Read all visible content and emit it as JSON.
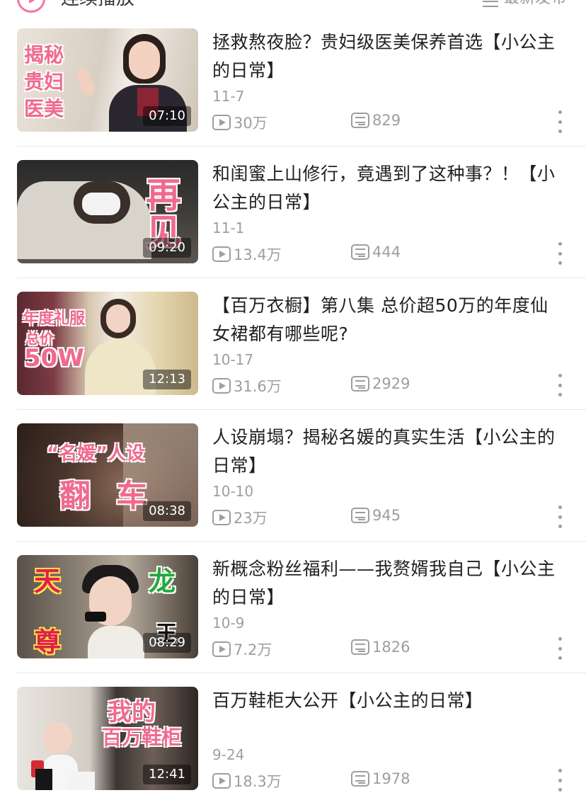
{
  "header": {
    "autoplay_label": "连续播放",
    "sort_label": "最新发布"
  },
  "videos": [
    {
      "title": "拯救熬夜脸？贵妇级医美保养首选【小公主的日常】",
      "date": "11-7",
      "views": "30万",
      "danmaku": "829",
      "duration": "07:10",
      "cover_text": [
        "揭秘",
        "贵妇",
        "医美"
      ]
    },
    {
      "title": "和闺蜜上山修行，竟遇到了这种事？！【小公主的日常】",
      "date": "11-1",
      "views": "13.4万",
      "danmaku": "444",
      "duration": "09:20",
      "cover_text": [
        "再",
        "见"
      ]
    },
    {
      "title": "【百万衣橱】第八集  总价超50万的年度仙女裙都有哪些呢?",
      "date": "10-17",
      "views": "31.6万",
      "danmaku": "2929",
      "duration": "12:13",
      "cover_text": [
        "年度礼服",
        "总价",
        "50W"
      ]
    },
    {
      "title": "人设崩塌？揭秘名媛的真实生活【小公主的日常】",
      "date": "10-10",
      "views": "23万",
      "danmaku": "945",
      "duration": "08:38",
      "cover_text": [
        "“名媛”人设",
        "翻",
        "车"
      ]
    },
    {
      "title": "新概念粉丝福利——我赘婿我自己【小公主的日常】",
      "date": "10-9",
      "views": "7.2万",
      "danmaku": "1826",
      "duration": "08:29",
      "cover_text": [
        "天",
        "尊",
        "龙",
        "王"
      ]
    },
    {
      "title": "百万鞋柜大公开【小公主的日常】",
      "date": "9-24",
      "views": "18.3万",
      "danmaku": "1978",
      "duration": "12:41",
      "cover_text": [
        "我的",
        "百万鞋柜"
      ]
    }
  ],
  "colors": {
    "accent": "#fb7299",
    "meta": "#9e9e9e",
    "title": "#212121"
  }
}
